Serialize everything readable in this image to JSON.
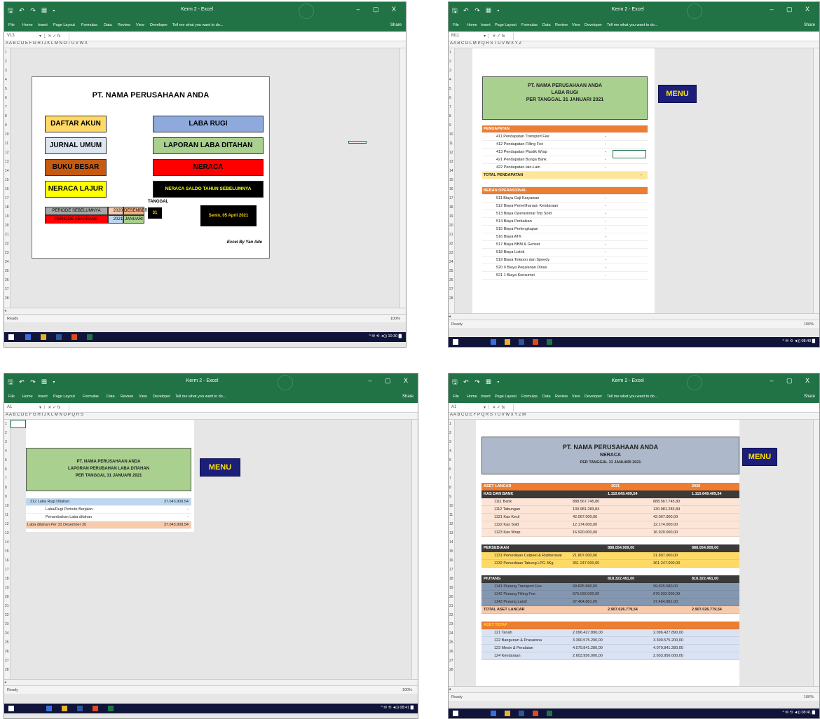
{
  "common": {
    "window_controls": "–  ▢  X",
    "share": "Share",
    "ribbon_tabs": [
      "File",
      "Home",
      "Insert",
      "Page Layout",
      "Formulas",
      "Data",
      "Review",
      "View",
      "Developer"
    ],
    "tell_me": "Tell me what you want to do...",
    "status_ready": "Ready",
    "zoom": "100%"
  },
  "shot1": {
    "title": "Kerm 2 - Excel",
    "name_box": "V13",
    "columns": "A  A  B C          D              E     F        G      H        I       J                  K                  L M   N      O      T       U       V       W     X",
    "rows": [
      "1",
      "2",
      "3",
      "4",
      "5",
      "6",
      "7",
      "8",
      "9",
      "10",
      "11",
      "12",
      "13",
      "14",
      "15",
      "16",
      "17",
      "18",
      "19",
      "20",
      "21",
      "22",
      "23",
      "24",
      "25",
      "26",
      "27",
      "28"
    ],
    "company": "PT. NAMA PERUSAHAAN ANDA",
    "buttons_left": [
      {
        "label": "DAFTAR AKUN",
        "bg": "#ffd966",
        "fg": "#000"
      },
      {
        "label": "JURNAL UMUM",
        "bg": "#dce6f1",
        "fg": "#000"
      },
      {
        "label": "BUKU BESAR",
        "bg": "#c55a11",
        "fg": "#000"
      },
      {
        "label": "NERACA LAJUR",
        "bg": "#ffff00",
        "fg": "#000"
      }
    ],
    "buttons_right": [
      {
        "label": "LABA RUGI",
        "bg": "#8ea9db",
        "fg": "#000"
      },
      {
        "label": "LAPORAN LABA DITAHAN",
        "bg": "#a9d08e",
        "fg": "#000"
      },
      {
        "label": "NERACA",
        "bg": "#ff0000",
        "fg": "#000"
      },
      {
        "label": "NERACA SALDO TAHUN SEBELUMNYA",
        "bg": "#000000",
        "fg": "#ffff00"
      }
    ],
    "period_prev_label": "PERIODE SEBELUMNYA",
    "period_prev_year": "2020",
    "period_prev_month": "DESEMBER",
    "period_curr_label": "PERIODE SEKARANG",
    "period_curr_year": "2021",
    "period_curr_month": "JANUARI",
    "tanggal_label": "TANGGAL",
    "tanggal_value": "31",
    "date_box": "Senin, 05 April 2021",
    "credit": "Excel By Yan Ade"
  },
  "shot2": {
    "title": "Kerm 2 - Excel",
    "name_box": "M11",
    "columns": "A    A   B    C                     D                                   L              M        P Q    R       S       T      U      V      W       X       Y      Z",
    "header_line1": "PT. NAMA PERUSAHAAN ANDA",
    "header_line2": "LABA RUGI",
    "header_line3": "PER TANGGAL 31 JANUARI 2021",
    "menu": "MENU",
    "rows": [
      {
        "n": "8",
        "label": "PENDAPATAN",
        "v": "",
        "type": "section"
      },
      {
        "n": "9",
        "label": "411 Pendapatan Transport Fee",
        "v": "-",
        "type": "item"
      },
      {
        "n": "10",
        "label": "412 Pendapatan Filling Fee",
        "v": "-",
        "type": "item"
      },
      {
        "n": "11",
        "label": "413 Pendapatan Plastik Wrap",
        "v": "-",
        "type": "item"
      },
      {
        "n": "12",
        "label": "421 Pendapatan Bunga Bank",
        "v": "-",
        "type": "item"
      },
      {
        "n": "13",
        "label": "422 Pendapatan lain-Lain",
        "v": "-",
        "type": "item"
      },
      {
        "n": "14",
        "label": "TOTAL PENDAPATAN",
        "v": "-",
        "type": "total"
      },
      {
        "n": "15",
        "label": "",
        "v": "",
        "type": "blank"
      },
      {
        "n": "16",
        "label": "BEBAN OPERASIONAL",
        "v": "",
        "type": "section"
      },
      {
        "n": "17",
        "label": "511 Biaya Gaji Karyawan",
        "v": "-",
        "type": "item"
      },
      {
        "n": "18",
        "label": "512 Biaya Pemeliharaan Kendaraan",
        "v": "-",
        "type": "item"
      },
      {
        "n": "19",
        "label": "513 Biaya Operasional Trip Sold",
        "v": "-",
        "type": "item"
      },
      {
        "n": "20",
        "label": "514 Biaya Perbaikan",
        "v": "-",
        "type": "item"
      },
      {
        "n": "21",
        "label": "515 Biaya Perlengkapan",
        "v": "-",
        "type": "item"
      },
      {
        "n": "22",
        "label": "516 Biaya ATK",
        "v": "-",
        "type": "item"
      },
      {
        "n": "23",
        "label": "517 Biaya BBM & Genset",
        "v": "-",
        "type": "item"
      },
      {
        "n": "24",
        "label": "518 Biaya Listrik",
        "v": "-",
        "type": "item"
      },
      {
        "n": "25",
        "label": "519 Biaya Telepon dan Speedy",
        "v": "-",
        "type": "item"
      },
      {
        "n": "26",
        "label": "520 0 Biaya Perjalanan Dinas",
        "v": "-",
        "type": "item"
      },
      {
        "n": "27",
        "label": "521 1 Biaya Konsumsi",
        "v": "-",
        "type": "item"
      }
    ]
  },
  "shot3": {
    "title": "Kerm 2 - Excel",
    "name_box": "A1",
    "columns": "A   A  B  C                D                         E          F                        G                H  I       J         K          L          M          N          O          P          Q          R          S",
    "header_line1": "PT. NAMA PERUSAHAAN ANDA",
    "header_line2": "LAPORAN PERUBAHAN LABA DITAHAN",
    "header_line3": "PER TANGGAL 31 JANUARI 2021",
    "menu": "MENU",
    "rows": [
      {
        "label": "312 Laba Rugi Ditahan",
        "v": "37.043.909,54",
        "type": "blue"
      },
      {
        "label": "Laba/Rugi Periode Berjalan",
        "v": "-",
        "type": "sub"
      },
      {
        "label": "Penambahan Laba ditahan",
        "v": "-",
        "type": "sub"
      },
      {
        "label": "Laba ditahan Per 31 Desember 20",
        "v": "37.043.909,54",
        "type": "peach"
      }
    ]
  },
  "shot4": {
    "title": "Kerm 2 - Excel",
    "name_box": "A1",
    "columns": "A    A    B C D   E                       F                                       P                      Q          R S          T                         U                         V W   X      Y      Z     M",
    "header_line1": "PT. NAMA PERUSAHAAN ANDA",
    "header_line2": "NERACA",
    "header_line3": "PER TANGGAL 31 JANUARI 2021",
    "menu": "MENU",
    "section_title": "ASET LANCAR",
    "year1": "2021",
    "year2": "2020",
    "groups": [
      {
        "name": "KAS DAN BANK",
        "total": "1.110.649.409,54",
        "color": "#fce4d6",
        "items": [
          {
            "label": "1111 Bank",
            "a": "888.567.745,80",
            "b": "888.567.745,80"
          },
          {
            "label": "1112 Tabungan",
            "a": "130.981.283,84",
            "b": "130.981.283,84"
          },
          {
            "label": "1121 Kas Kecil",
            "a": "42.067.000,00",
            "b": "42.067.000,00"
          },
          {
            "label": "1122 Kas Sold",
            "a": "12.174.000,00",
            "b": "12.174.000,00"
          },
          {
            "label": "1123 Kas Wrap",
            "a": "16.920.000,00",
            "b": "16.920.000,00"
          }
        ]
      },
      {
        "name": "PERSEDIAAN",
        "total": "888.054.909,00",
        "color": "#ffd966",
        "items": [
          {
            "label": "1131 Persediaan Cutpeel & Rubberseal",
            "a": "21.807.000,00",
            "b": "21.807.000,00"
          },
          {
            "label": "1132 Persediaan Tabung LPG 3Kg",
            "a": "361.247.000,00",
            "b": "361.247.000,00"
          }
        ]
      },
      {
        "name": "PIUTANG",
        "total": "818.322.461,00",
        "color": "#8497b0",
        "items": [
          {
            "label": "1141 Piutang Transport Fee",
            "a": "99.825.580,00",
            "b": "99.825.580,00"
          },
          {
            "label": "1142 Piutang Filling Fee",
            "a": "676.032.000,00",
            "b": "676.032.000,00"
          },
          {
            "label": "1143 Piutang Lain2",
            "a": "37.464.881,00",
            "b": "37.464.881,00"
          }
        ]
      }
    ],
    "total_label": "TOTAL ASET LANCAR",
    "total_a": "2.907.026.779,54",
    "total_b": "2.907.026.779,54",
    "fixed_title": "ASET TETAP",
    "fixed": [
      {
        "label": "121 Tanah",
        "a": "2.096.427.890,00",
        "b": "2.096.427.890,00"
      },
      {
        "label": "122 Bangunan & Prasarana",
        "a": "3.390.575.200,00",
        "b": "3.390.575.200,00"
      },
      {
        "label": "123 Mesin & Peralatan",
        "a": "4.079.841.280,00",
        "b": "4.079.841.280,00"
      },
      {
        "label": "124 Kendaraan",
        "a": "2.603.956.000,00",
        "b": "2.603.956.000,00"
      }
    ]
  }
}
